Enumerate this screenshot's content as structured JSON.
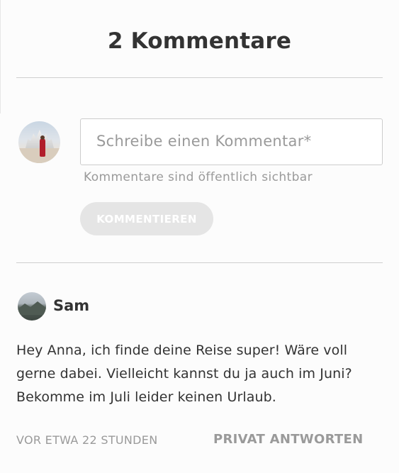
{
  "header": {
    "title": "2 Kommentare"
  },
  "composer": {
    "placeholder": "Schreibe einen Kommentar*",
    "hint": "Kommentare sind öffentlich sichtbar",
    "submit_label": "KOMMENTIEREN"
  },
  "comments": [
    {
      "author": "Sam",
      "text": "Hey Anna, ich finde deine Reise super! Wäre voll gerne dabei. Vielleicht kannst du ja auch im Juni? Bekomme im Juli leider keinen Urlaub.",
      "timestamp": "VOR ETWA 22 STUNDEN",
      "reply_label": "PRIVAT ANTWORTEN"
    }
  ],
  "colors": {
    "background": "#fcfcfc",
    "text": "#333333",
    "muted": "#9a9a9a",
    "button_disabled": "#e5e5e5",
    "divider": "#cfcfcf"
  }
}
